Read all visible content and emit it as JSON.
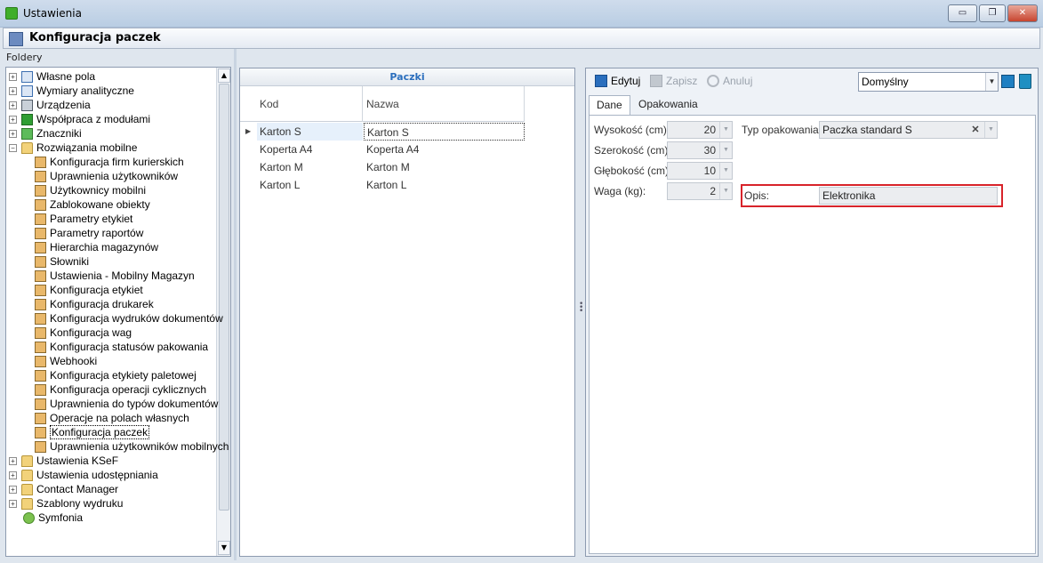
{
  "window": {
    "title": "Ustawienia",
    "minimize": "▭",
    "restore": "❐",
    "close": "✕"
  },
  "header": {
    "title": "Konfiguracja paczek"
  },
  "left_panel": {
    "label": "Foldery",
    "items": [
      {
        "label": "Własne pola",
        "icon": "doc-icon",
        "level": 0,
        "expander": "+"
      },
      {
        "label": "Wymiary analityczne",
        "icon": "doc-icon",
        "level": 0,
        "expander": "+"
      },
      {
        "label": "Urządzenia",
        "icon": "printer-icon",
        "level": 0,
        "expander": "+"
      },
      {
        "label": "Współpraca z modułami",
        "icon": "module-icon",
        "level": 0,
        "expander": "+"
      },
      {
        "label": "Znaczniki",
        "icon": "tag-icon",
        "level": 0,
        "expander": "+"
      },
      {
        "label": "Rozwiązania mobilne",
        "icon": "folder-icon",
        "level": 0,
        "expander": "−"
      },
      {
        "label": "Konfiguracja firm kurierskich",
        "icon": "settings-icon",
        "level": 1
      },
      {
        "label": "Uprawnienia użytkowników",
        "icon": "settings-icon",
        "level": 1
      },
      {
        "label": "Użytkownicy mobilni",
        "icon": "settings-icon",
        "level": 1
      },
      {
        "label": "Zablokowane obiekty",
        "icon": "settings-icon",
        "level": 1
      },
      {
        "label": "Parametry etykiet",
        "icon": "settings-icon",
        "level": 1
      },
      {
        "label": "Parametry raportów",
        "icon": "settings-icon",
        "level": 1
      },
      {
        "label": "Hierarchia magazynów",
        "icon": "settings-icon",
        "level": 1
      },
      {
        "label": "Słowniki",
        "icon": "settings-icon",
        "level": 1
      },
      {
        "label": "Ustawienia - Mobilny Magazyn",
        "icon": "settings-icon",
        "level": 1
      },
      {
        "label": "Konfiguracja etykiet",
        "icon": "settings-icon",
        "level": 1
      },
      {
        "label": "Konfiguracja drukarek",
        "icon": "settings-icon",
        "level": 1
      },
      {
        "label": "Konfiguracja wydruków dokumentów",
        "icon": "settings-icon",
        "level": 1
      },
      {
        "label": "Konfiguracja wag",
        "icon": "settings-icon",
        "level": 1
      },
      {
        "label": "Konfiguracja statusów pakowania",
        "icon": "settings-icon",
        "level": 1
      },
      {
        "label": "Webhooki",
        "icon": "settings-icon",
        "level": 1
      },
      {
        "label": "Konfiguracja etykiety paletowej",
        "icon": "settings-icon",
        "level": 1
      },
      {
        "label": "Konfiguracja operacji cyklicznych",
        "icon": "settings-icon",
        "level": 1
      },
      {
        "label": "Uprawnienia do typów dokumentów",
        "icon": "settings-icon",
        "level": 1
      },
      {
        "label": "Operacje na polach własnych",
        "icon": "settings-icon",
        "level": 1
      },
      {
        "label": "Konfiguracja paczek",
        "icon": "settings-icon",
        "level": 1,
        "selected": true
      },
      {
        "label": "Uprawnienia użytkowników mobilnych",
        "icon": "settings-icon",
        "level": 1
      },
      {
        "label": "Ustawienia KSeF",
        "icon": "folder-icon",
        "level": 0,
        "expander": "+"
      },
      {
        "label": "Ustawienia udostępniania",
        "icon": "folder-icon",
        "level": 0,
        "expander": "+"
      },
      {
        "label": "Contact Manager",
        "icon": "folder-icon",
        "level": 0,
        "expander": "+"
      },
      {
        "label": "Szablony wydruku",
        "icon": "folder-icon",
        "level": 0,
        "expander": "+"
      },
      {
        "label": "Symfonia",
        "icon": "symfonia-icon",
        "level": 0
      }
    ]
  },
  "grid": {
    "title": "Paczki",
    "columns": [
      "Kod",
      "Nazwa"
    ],
    "rows": [
      {
        "kod": "Karton S",
        "nazwa": "Karton S",
        "active": true
      },
      {
        "kod": "Koperta A4",
        "nazwa": "Koperta A4"
      },
      {
        "kod": "Karton M",
        "nazwa": "Karton M"
      },
      {
        "kod": "Karton L",
        "nazwa": "Karton L"
      }
    ],
    "row_indicator": "▶"
  },
  "details": {
    "toolbar": {
      "edit": "Edytuj",
      "save": "Zapisz",
      "cancel": "Anuluj",
      "profile": "Domyślny"
    },
    "tabs": [
      "Dane",
      "Opakowania"
    ],
    "fields": {
      "wysokosc_label": "Wysokość (cm):",
      "wysokosc": "20",
      "szerokosc_label": "Szerokość (cm):",
      "szerokosc": "30",
      "glebokosc_label": "Głębokość (cm):",
      "glebokosc": "10",
      "waga_label": "Waga (kg):",
      "waga": "2",
      "typ_label": "Typ opakowania:",
      "typ": "Paczka standard S",
      "opis_label": "Opis:",
      "opis": "Elektronika"
    },
    "clear_symbol": "✕",
    "highlight_color": "#d8232a"
  },
  "colors": {
    "accent": "#2a6ebd",
    "titlebar": "#b9cde3",
    "selection": "#e6f0fb"
  }
}
